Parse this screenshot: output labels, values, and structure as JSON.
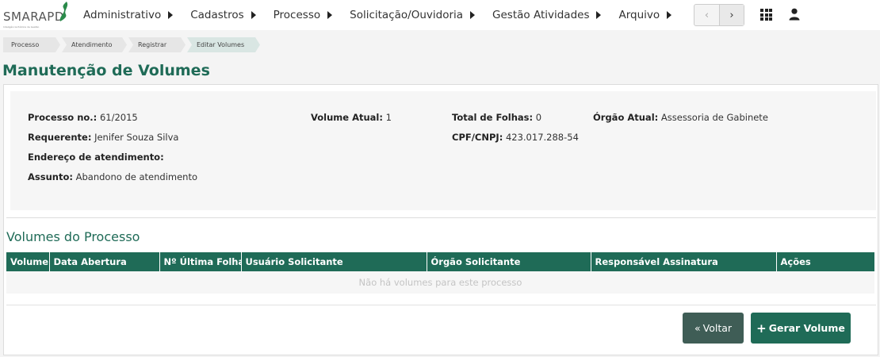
{
  "app": {
    "logo_text": "SMARAPD",
    "logo_subtitle": "Inteligência Pública de Gestão",
    "brand_color": "#1f6b57"
  },
  "menu": {
    "items": [
      {
        "label": "Administrativo"
      },
      {
        "label": "Cadastros"
      },
      {
        "label": "Processo"
      },
      {
        "label": "Solicitação/Ouvidoria"
      },
      {
        "label": "Gestão Atividades"
      },
      {
        "label": "Arquivo"
      }
    ]
  },
  "pager": {
    "prev_icon": "‹",
    "next_icon": "›"
  },
  "breadcrumb": [
    "Processo",
    "Atendimento",
    "Registrar",
    "Editar Volumes"
  ],
  "page_title": "Manutenção de Volumes",
  "process": {
    "numero_label": "Processo no.:",
    "numero_value": "61/2015",
    "volume_label": "Volume Atual:",
    "volume_value": "1",
    "folhas_label": "Total de Folhas:",
    "folhas_value": "0",
    "orgao_label": "Órgão Atual:",
    "orgao_value": "Assessoria de Gabinete",
    "requerente_label": "Requerente:",
    "requerente_value": "Jenifer Souza Silva",
    "cpf_label": "CPF/CNPJ:",
    "cpf_value": "423.017.288-54",
    "endereco_label": "Endereço de atendimento:",
    "endereco_value": "",
    "assunto_label": "Assunto:",
    "assunto_value": "Abandono de atendimento"
  },
  "volumes": {
    "title": "Volumes do Processo",
    "columns": [
      "Volume",
      "Data Abertura",
      "Nº Última Folha",
      "Usuário Solicitante",
      "Órgão Solicitante",
      "Responsável Assinatura",
      "Ações"
    ],
    "empty_message": "Não há volumes para este processo"
  },
  "buttons": {
    "back_label": "Voltar",
    "back_icon": "«",
    "generate_label": "Gerar Volume",
    "generate_icon": "+"
  }
}
